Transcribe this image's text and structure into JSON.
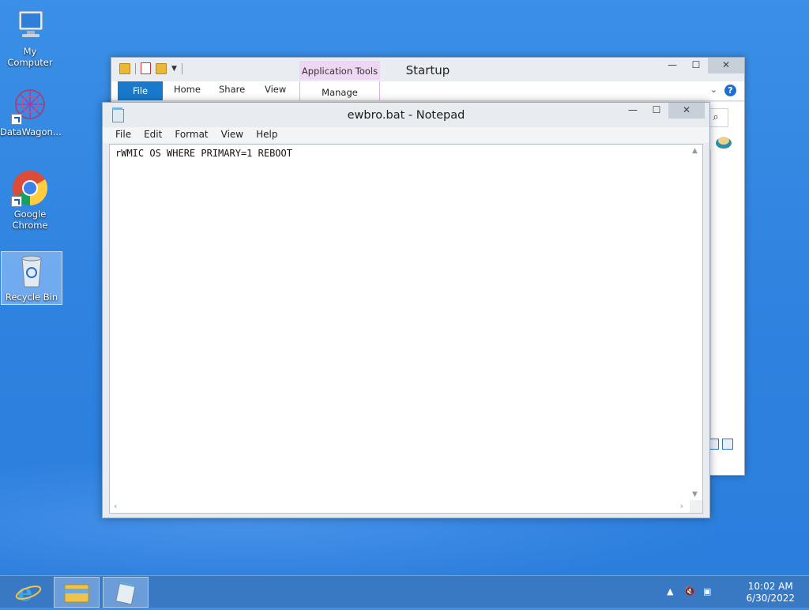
{
  "desktop": {
    "icons": [
      {
        "label": "My Computer"
      },
      {
        "label": "DataWagon..."
      },
      {
        "label": "Google Chrome"
      },
      {
        "label": "Recycle Bin"
      }
    ]
  },
  "explorer": {
    "title": "Startup",
    "contextual_group": "Application Tools",
    "tabs": [
      "File",
      "Home",
      "Share",
      "View",
      "Manage"
    ],
    "search_icon": "magnifier-icon"
  },
  "notepad": {
    "title": "ewbro.bat - Notepad",
    "menu": [
      "File",
      "Edit",
      "Format",
      "View",
      "Help"
    ],
    "content": "rWMIC OS WHERE PRIMARY=1 REBOOT"
  },
  "taskbar": {
    "time": "10:02 AM",
    "date": "6/30/2022"
  },
  "colors": {
    "desktop": "#2f84e0",
    "file_tab": "#1979ca",
    "contextual_tab": "#eed7f2"
  }
}
